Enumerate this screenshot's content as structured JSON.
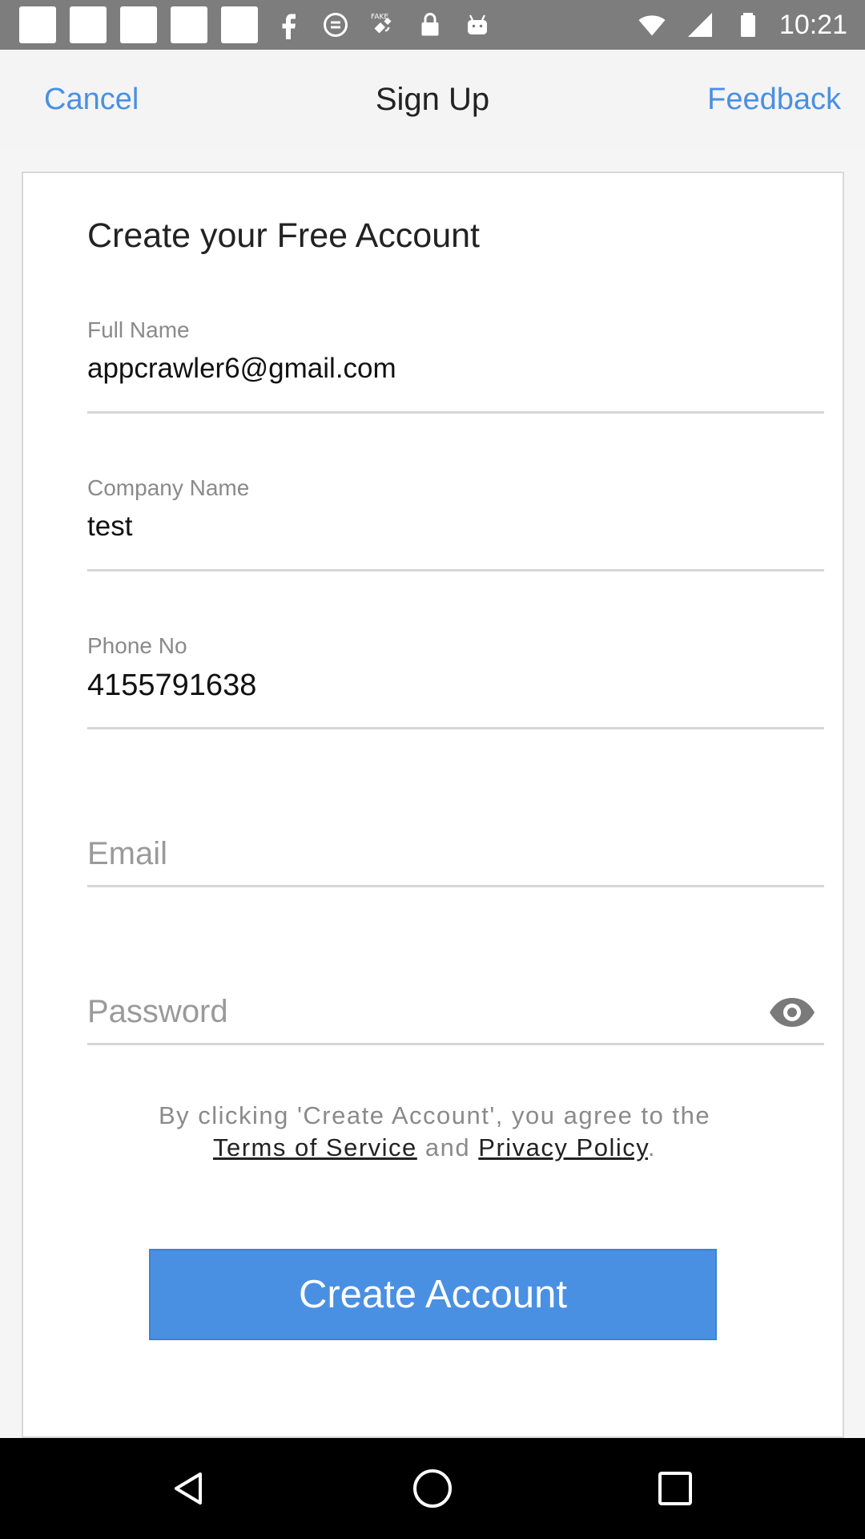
{
  "status_bar": {
    "time": "10:21",
    "icons": [
      "notification-square",
      "notification-square",
      "notification-square",
      "notification-square",
      "notification-square",
      "facebook-icon",
      "no-sim-icon",
      "fake-gps-icon",
      "lock-icon",
      "android-icon",
      "wifi-icon",
      "signal-icon",
      "battery-icon"
    ],
    "fake_gps_badge": "FAKE"
  },
  "header": {
    "cancel": "Cancel",
    "title": "Sign Up",
    "feedback": "Feedback",
    "link_color": "#4a90e2"
  },
  "card": {
    "title": "Create your Free Account"
  },
  "form": {
    "full_name": {
      "label": "Full Name",
      "value": "appcrawler6@gmail.com"
    },
    "company": {
      "label": "Company Name",
      "value": "test"
    },
    "phone": {
      "label": "Phone No",
      "value": "4155791638"
    },
    "email": {
      "placeholder": "Email"
    },
    "password": {
      "placeholder": "Password",
      "toggle_icon": "eye-icon"
    }
  },
  "terms": {
    "prefix": "By clicking 'Create Account', you agree to the",
    "terms_link": "Terms of Service",
    "conjunction": "and",
    "privacy_link": "Privacy Policy",
    "suffix": "."
  },
  "create_button": {
    "label": "Create Account",
    "color": "#4a90e2"
  },
  "nav": {
    "icons": [
      "back-icon",
      "home-icon",
      "recents-icon"
    ]
  }
}
